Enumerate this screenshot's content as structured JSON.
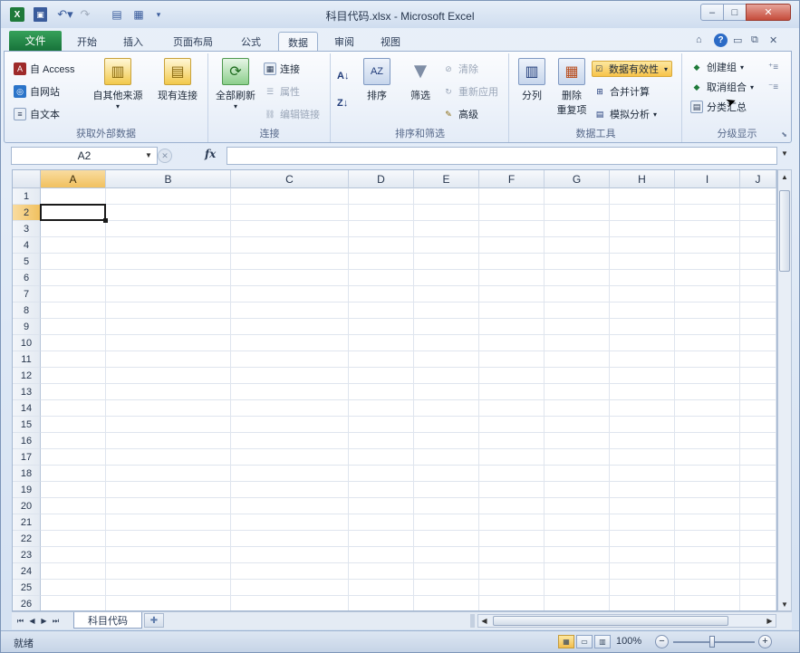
{
  "window": {
    "title": "科目代码.xlsx - Microsoft Excel",
    "app_icon": "X",
    "min": "–",
    "max": "□",
    "close": "✕"
  },
  "quick_access": {
    "save_icon": "save-icon",
    "undo_icon": "undo-icon",
    "redo_icon": "redo-icon"
  },
  "tabs": {
    "file": "文件",
    "items": [
      {
        "label": "开始",
        "active": false
      },
      {
        "label": "插入",
        "active": false
      },
      {
        "label": "页面布局",
        "active": false
      },
      {
        "label": "公式",
        "active": false
      },
      {
        "label": "数据",
        "active": true
      },
      {
        "label": "审阅",
        "active": false
      },
      {
        "label": "视图",
        "active": false
      }
    ]
  },
  "ribbon": {
    "get_external": {
      "label": "获取外部数据",
      "access": "自 Access",
      "web": "自网站",
      "text": "自文本",
      "other": "自其他来源"
    },
    "existing": {
      "label": "现有连接"
    },
    "connections": {
      "label": "连接",
      "refresh_all": "全部刷新",
      "connections": "连接",
      "properties": "属性",
      "edit_links": "编辑链接"
    },
    "sort_filter": {
      "label": "排序和筛选",
      "sort": "排序",
      "filter": "筛选",
      "clear": "清除",
      "reapply": "重新应用",
      "advanced": "高级",
      "az_icon": "A↓",
      "za_icon": "Z↓"
    },
    "data_tools": {
      "label": "数据工具",
      "text_to_columns": "分列",
      "remove_duplicates_line1": "删除",
      "remove_duplicates_line2": "重复项",
      "data_validation": "数据有效性",
      "consolidate": "合并计算",
      "what_if": "模拟分析"
    },
    "outline": {
      "label": "分级显示",
      "group": "创建组",
      "ungroup": "取消组合",
      "subtotal": "分类汇总"
    }
  },
  "formula_bar": {
    "name_box": "A2",
    "fx": "fx",
    "value": ""
  },
  "grid": {
    "columns": [
      "A",
      "B",
      "C",
      "D",
      "E",
      "F",
      "G",
      "H",
      "I",
      "J"
    ],
    "rows": [
      "1",
      "2",
      "3",
      "4",
      "5",
      "6",
      "7",
      "8",
      "9",
      "10",
      "11",
      "12",
      "13",
      "14",
      "15",
      "16",
      "17",
      "18",
      "19",
      "20",
      "21",
      "22",
      "23",
      "24",
      "25",
      "26"
    ],
    "selected_column": "A",
    "selected_row": "2"
  },
  "sheet_tabs": {
    "active": "科目代码"
  },
  "status": {
    "ready": "就绪",
    "zoom": "100%",
    "zoom_minus": "−",
    "zoom_plus": "+"
  }
}
